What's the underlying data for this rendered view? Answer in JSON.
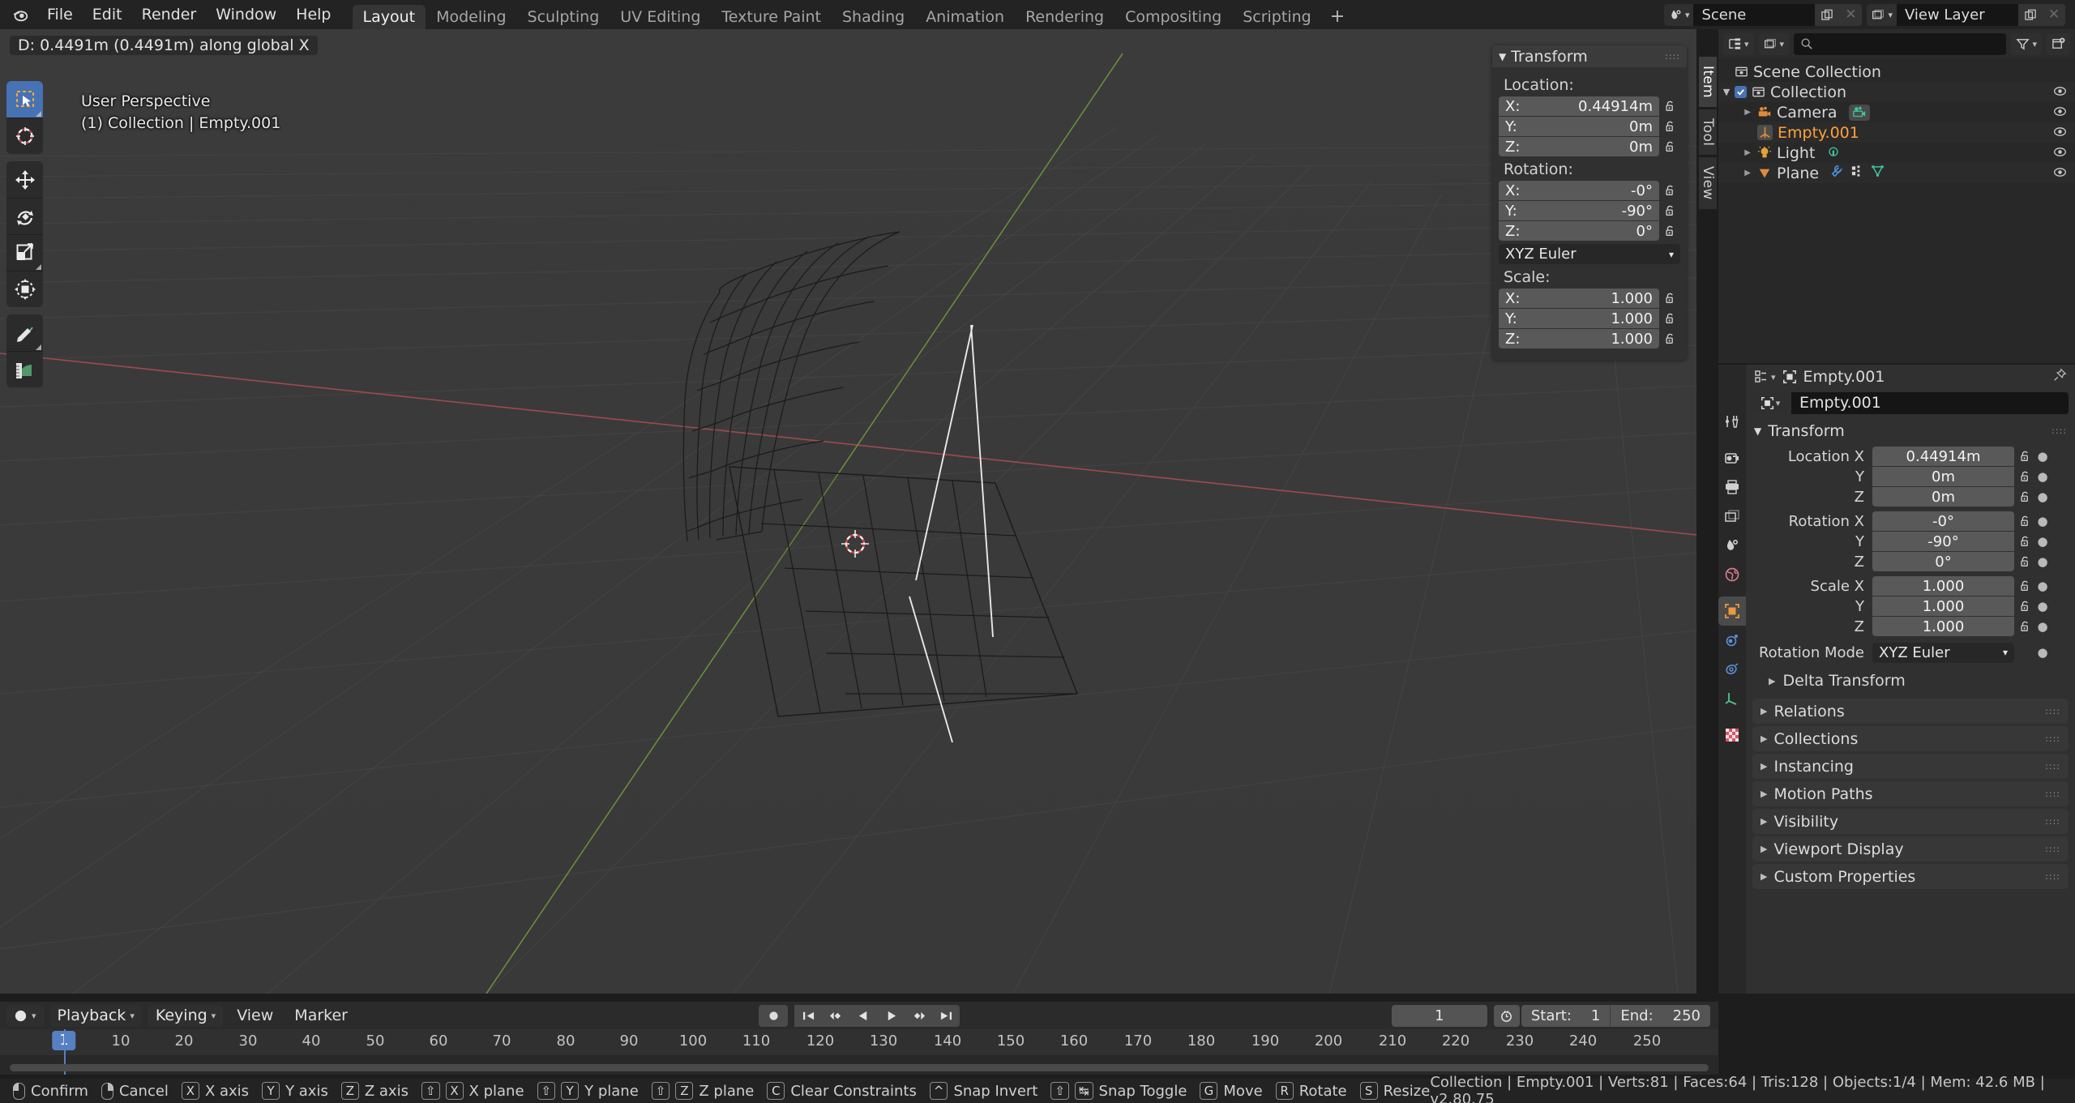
{
  "app": {
    "version_label": "v2.80.75"
  },
  "topbar": {
    "menus": [
      "File",
      "Edit",
      "Render",
      "Window",
      "Help"
    ],
    "workspaces": [
      {
        "label": "Layout",
        "active": true
      },
      {
        "label": "Modeling",
        "active": false
      },
      {
        "label": "Sculpting",
        "active": false
      },
      {
        "label": "UV Editing",
        "active": false
      },
      {
        "label": "Texture Paint",
        "active": false
      },
      {
        "label": "Shading",
        "active": false
      },
      {
        "label": "Animation",
        "active": false
      },
      {
        "label": "Rendering",
        "active": false
      },
      {
        "label": "Compositing",
        "active": false
      },
      {
        "label": "Scripting",
        "active": false
      }
    ],
    "add_workspace": "+",
    "scene_name": "Scene",
    "view_layer_name": "View Layer"
  },
  "viewport": {
    "operator_status": "D: 0.4491m (0.4491m) along global X",
    "view_name": "User Perspective",
    "view_context": "(1) Collection | Empty.001",
    "tools": [
      {
        "name": "tweak-tool",
        "active": true
      },
      {
        "name": "cursor-tool",
        "active": false
      },
      {
        "name": "move-tool",
        "active": false
      },
      {
        "name": "rotate-tool",
        "active": false
      },
      {
        "name": "scale-tool",
        "active": false
      },
      {
        "name": "transform-tool",
        "active": false
      },
      {
        "name": "annotate-tool",
        "active": false
      },
      {
        "name": "measure-tool",
        "active": false
      }
    ],
    "side_tabs": [
      {
        "label": "Item",
        "active": true
      },
      {
        "label": "Tool",
        "active": false
      },
      {
        "label": "View",
        "active": false
      }
    ]
  },
  "npanel": {
    "title": "Transform",
    "location_label": "Location:",
    "rotation_label": "Rotation:",
    "scale_label": "Scale:",
    "location": [
      {
        "axis": "X:",
        "value": "0.44914m"
      },
      {
        "axis": "Y:",
        "value": "0m"
      },
      {
        "axis": "Z:",
        "value": "0m"
      }
    ],
    "rotation": [
      {
        "axis": "X:",
        "value": "-0°"
      },
      {
        "axis": "Y:",
        "value": "-90°"
      },
      {
        "axis": "Z:",
        "value": "0°"
      }
    ],
    "rotation_mode": "XYZ Euler",
    "scale": [
      {
        "axis": "X:",
        "value": "1.000"
      },
      {
        "axis": "Y:",
        "value": "1.000"
      },
      {
        "axis": "Z:",
        "value": "1.000"
      }
    ]
  },
  "outliner": {
    "search_placeholder": "",
    "rows": [
      {
        "label": "Scene Collection",
        "indent": 0,
        "icon": "scene-collection-icon",
        "disclosure": "",
        "checkbox": false,
        "selected": false,
        "eye": true,
        "extras": []
      },
      {
        "label": "Collection",
        "indent": 1,
        "icon": "collection-icon",
        "disclosure": "down",
        "checkbox": true,
        "selected": false,
        "eye": true,
        "extras": []
      },
      {
        "label": "Camera",
        "indent": 2,
        "icon": "camera-object-icon",
        "disclosure": "right",
        "checkbox": false,
        "selected": false,
        "eye": true,
        "extras": [
          "camera-data-icon"
        ]
      },
      {
        "label": "Empty.001",
        "indent": 2,
        "icon": "empty-axis-icon",
        "disclosure": "",
        "checkbox": false,
        "selected": true,
        "eye": true,
        "extras": []
      },
      {
        "label": "Light",
        "indent": 2,
        "icon": "light-object-icon",
        "disclosure": "right",
        "checkbox": false,
        "selected": false,
        "eye": true,
        "extras": [
          "light-data-icon"
        ]
      },
      {
        "label": "Plane",
        "indent": 2,
        "icon": "mesh-object-icon",
        "disclosure": "right",
        "checkbox": false,
        "selected": false,
        "eye": true,
        "extras": [
          "modifier-icon",
          "vertex-group-icon",
          "mesh-data-icon"
        ]
      }
    ]
  },
  "properties": {
    "breadcrumb": "Empty.001",
    "id_name": "Empty.001",
    "transform_title": "Transform",
    "rows": [
      {
        "label": "Location X",
        "value": "0.44914m"
      },
      {
        "label": "Y",
        "value": "0m"
      },
      {
        "label": "Z",
        "value": "0m"
      }
    ],
    "rotation_rows": [
      {
        "label": "Rotation X",
        "value": "-0°"
      },
      {
        "label": "Y",
        "value": "-90°"
      },
      {
        "label": "Z",
        "value": "0°"
      }
    ],
    "scale_rows": [
      {
        "label": "Scale X",
        "value": "1.000"
      },
      {
        "label": "Y",
        "value": "1.000"
      },
      {
        "label": "Z",
        "value": "1.000"
      }
    ],
    "rotation_mode_label": "Rotation Mode",
    "rotation_mode_value": "XYZ Euler",
    "delta_transform": "Delta Transform",
    "panels": [
      "Relations",
      "Collections",
      "Instancing",
      "Motion Paths",
      "Visibility",
      "Viewport Display",
      "Custom Properties"
    ],
    "tabs": [
      {
        "name": "tool-tab",
        "active": false
      },
      {
        "name": "render-tab",
        "active": false
      },
      {
        "name": "output-tab",
        "active": false
      },
      {
        "name": "view-layer-tab",
        "active": false
      },
      {
        "name": "scene-tab",
        "active": false
      },
      {
        "name": "world-tab",
        "active": false
      },
      {
        "name": "object-tab",
        "active": true
      },
      {
        "name": "physics-tab",
        "active": false
      },
      {
        "name": "constraints-tab",
        "active": false
      },
      {
        "name": "object-data-tab",
        "active": false
      },
      {
        "name": "texture-tab",
        "active": false
      }
    ]
  },
  "timeline": {
    "menus": [
      "Playback",
      "Keying",
      "View",
      "Marker"
    ],
    "current_frame": "1",
    "start_label": "Start:",
    "start_value": "1",
    "end_label": "End:",
    "end_value": "250",
    "ticks": [
      "10",
      "20",
      "30",
      "40",
      "50",
      "60",
      "70",
      "80",
      "90",
      "100",
      "110",
      "120",
      "130",
      "140",
      "150",
      "160",
      "170",
      "180",
      "190",
      "200",
      "210",
      "220",
      "230",
      "240",
      "250"
    ],
    "playhead": "1"
  },
  "statusbar": {
    "items": [
      {
        "keys": [
          "lmb"
        ],
        "label": "Confirm"
      },
      {
        "keys": [
          "rmb"
        ],
        "label": "Cancel"
      },
      {
        "keys": [
          "X"
        ],
        "label": "X axis"
      },
      {
        "keys": [
          "Y"
        ],
        "label": "Y axis"
      },
      {
        "keys": [
          "Z"
        ],
        "label": "Z axis"
      },
      {
        "keys": [
          "⇧",
          "X"
        ],
        "label": "X plane"
      },
      {
        "keys": [
          "⇧",
          "Y"
        ],
        "label": "Y plane"
      },
      {
        "keys": [
          "⇧",
          "Z"
        ],
        "label": "Z plane"
      },
      {
        "keys": [
          "C"
        ],
        "label": "Clear Constraints"
      },
      {
        "keys": [
          "^"
        ],
        "label": "Snap Invert"
      },
      {
        "keys": [
          "⇧",
          "↹"
        ],
        "label": "Snap Toggle"
      },
      {
        "keys": [
          "G"
        ],
        "label": "Move"
      },
      {
        "keys": [
          "R"
        ],
        "label": "Rotate"
      },
      {
        "keys": [
          "S"
        ],
        "label": "Resize"
      }
    ],
    "info": "Collection | Empty.001 | Verts:81 | Faces:64 | Tris:128 | Objects:1/4 | Mem: 42.6 MB | v2.80.75"
  }
}
